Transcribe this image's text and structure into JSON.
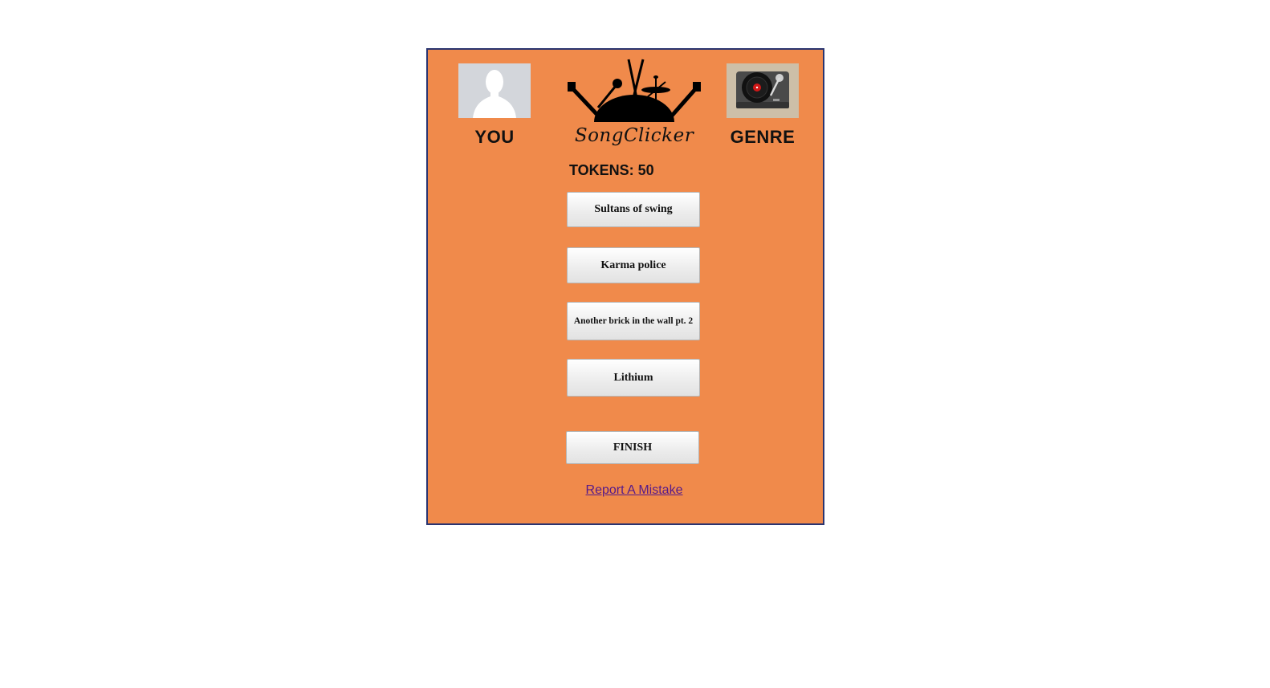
{
  "player": {
    "label": "YOU",
    "avatar_icon": "person-silhouette-icon"
  },
  "genre": {
    "label": "GENRE",
    "icon": "turntable-icon"
  },
  "logo": {
    "text": "SongClicker"
  },
  "tokens": {
    "text": "TOKENS: 50"
  },
  "songs": [
    {
      "label": "Sultans of swing"
    },
    {
      "label": "Karma police"
    },
    {
      "label": "Another brick in the wall pt. 2"
    },
    {
      "label": "Lithium"
    }
  ],
  "finish": {
    "label": "FINISH"
  },
  "report": {
    "label": "Report A Mistake"
  },
  "colors": {
    "panel_background": "#f08a4b",
    "panel_border": "#2a3470",
    "link": "#551a8b"
  }
}
